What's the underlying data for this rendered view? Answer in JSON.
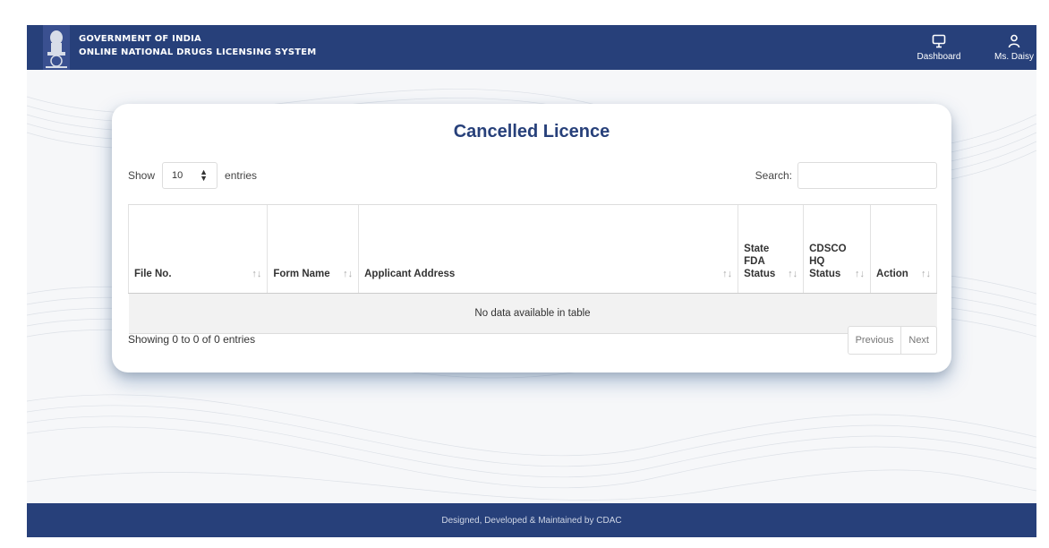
{
  "header": {
    "line1": "GOVERNMENT OF INDIA",
    "line2": "ONLINE NATIONAL DRUGS LICENSING SYSTEM",
    "nav": {
      "dashboard": "Dashboard",
      "user": "Ms. Daisy"
    }
  },
  "card": {
    "title": "Cancelled Licence",
    "show_label": "Show",
    "page_length": "10",
    "entries_label": "entries",
    "search_label": "Search:",
    "search_value": ""
  },
  "table": {
    "columns": [
      "File No.",
      "Form Name",
      "Applicant Address",
      "State FDA Status",
      "CDSCO HQ Status",
      "Action"
    ],
    "empty_message": "No data available in table"
  },
  "info": "Showing 0 to 0 of 0 entries",
  "pagination": {
    "previous": "Previous",
    "next": "Next"
  },
  "footer": "Designed, Developed & Maintained by CDAC",
  "colors": {
    "brand": "#27407a",
    "page_bg": "#f6f7f9"
  }
}
